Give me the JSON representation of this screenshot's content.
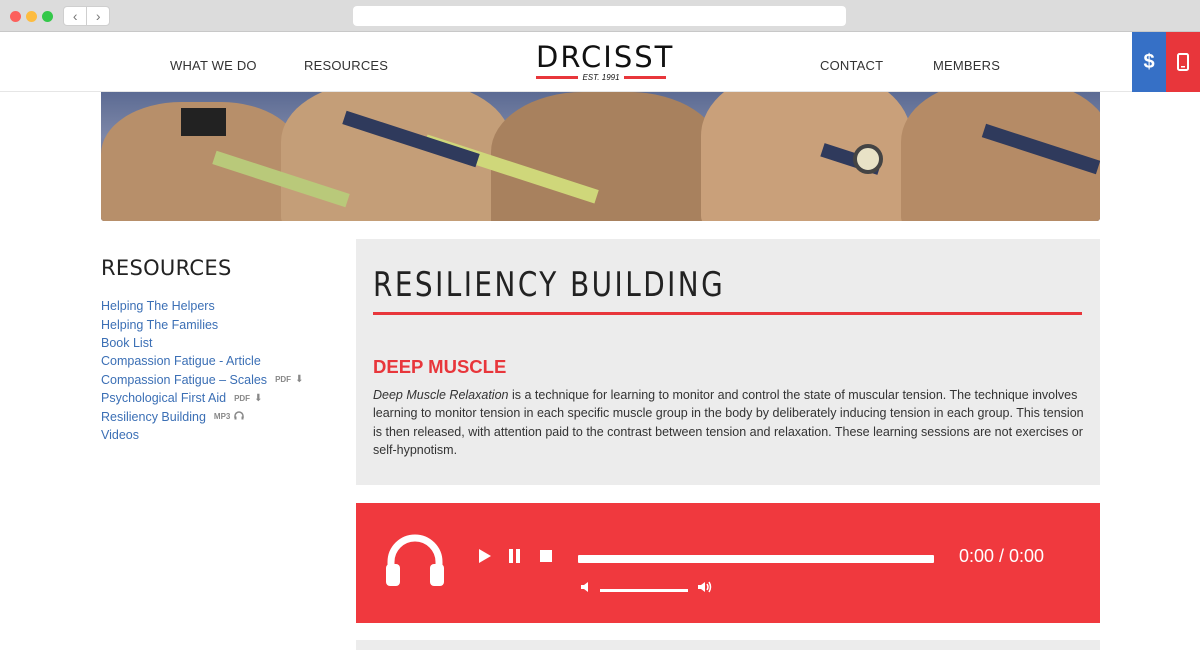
{
  "nav": {
    "left": [
      "WHAT WE DO",
      "RESOURCES"
    ],
    "right": [
      "CONTACT",
      "MEMBERS"
    ]
  },
  "logo": {
    "name": "DRCISST",
    "tagline": "EST. 1991"
  },
  "header_buttons": {
    "donate_icon": "$",
    "phone_icon": "mobile-phone-icon"
  },
  "sidebar": {
    "title": "RESOURCES",
    "items": [
      {
        "label": "Helping The Helpers"
      },
      {
        "label": "Helping The Families"
      },
      {
        "label": "Book List"
      },
      {
        "label": "Compassion Fatigue - Article"
      },
      {
        "label": "Compassion Fatigue – Scales",
        "tag": "PDF",
        "icon": "download-icon"
      },
      {
        "label": "Psychological First Aid",
        "tag": "PDF",
        "icon": "download-icon"
      },
      {
        "label": "Resiliency Building",
        "tag": "MP3",
        "icon": "headphones-icon"
      },
      {
        "label": "Videos"
      }
    ]
  },
  "main": {
    "title": "RESILIENCY BUILDING",
    "section_title": "DEEP MUSCLE",
    "body_emphasis": "Deep Muscle Relaxation",
    "body_rest": " is a technique for learning to monitor and control the state of muscular tension. The technique involves learning to monitor tension in each specific muscle group in the body by deliberately inducing tension in each group. This tension is then released, with attention paid to the contrast between tension and relaxation. These learning sessions are not exercises or self-hypnotism."
  },
  "player": {
    "time": "0:00 / 0:00"
  },
  "colors": {
    "accent": "#e8363b",
    "link": "#3b6fb5",
    "donate": "#3670c6",
    "player": "#f0393e"
  }
}
